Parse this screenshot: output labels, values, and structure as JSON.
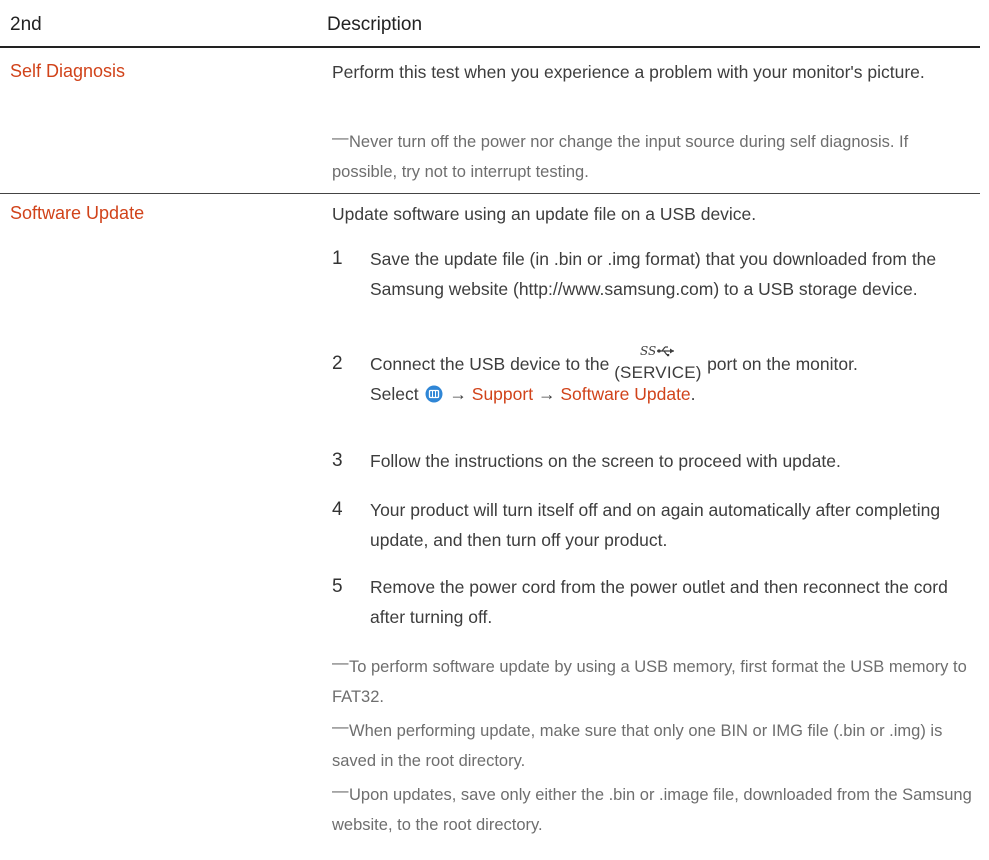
{
  "table": {
    "header_col1": "2nd",
    "header_col2": "Description"
  },
  "self_diagnosis": {
    "label": "Self Diagnosis",
    "description": "Perform this test when you experience a problem with your monitor's picture.",
    "note": "Never turn off the power nor change the input source during self diagnosis. If possible, try not to interrupt testing."
  },
  "software_update": {
    "label": "Software Update",
    "description": "Update software using an update file on a USB device.",
    "steps": [
      {
        "num": "1",
        "text": "Save the update file (in .bin or .img format) that you downloaded from the Samsung website (http://www.samsung.com) to a USB storage device."
      },
      {
        "num": "2",
        "text_before": "Connect the USB device to the",
        "port_label": "(SERVICE)",
        "text_after": "port on the monitor.",
        "select_label": "Select",
        "arrow": "→",
        "menu_support": "Support",
        "menu_software_update": "Software Update",
        "period": "."
      },
      {
        "num": "3",
        "text": "Follow the instructions on the screen to proceed with update."
      },
      {
        "num": "4",
        "text": "Your product will turn itself off and on again automatically after completing update, and then turn off your product."
      },
      {
        "num": "5",
        "text": "Remove the power cord from the power outlet and then reconnect the cord after turning off."
      }
    ],
    "notes": [
      "To perform software update by using a USB memory, first format the USB memory to FAT32.",
      "When performing update, make sure that only one BIN or IMG file (.bin or .img) is saved in the root directory.",
      "Upon updates, save only either the .bin or .image file, downloaded from the Samsung website, to the root directory."
    ],
    "note_dash": "―"
  },
  "icons": {
    "ss_usb": "superspeed-usb-icon",
    "menu": "menu-button-icon"
  },
  "colors": {
    "accent": "#d1431a",
    "text": "#3d3d3d",
    "note_text": "#6e6e6e",
    "menu_button": "#2f86d6"
  }
}
